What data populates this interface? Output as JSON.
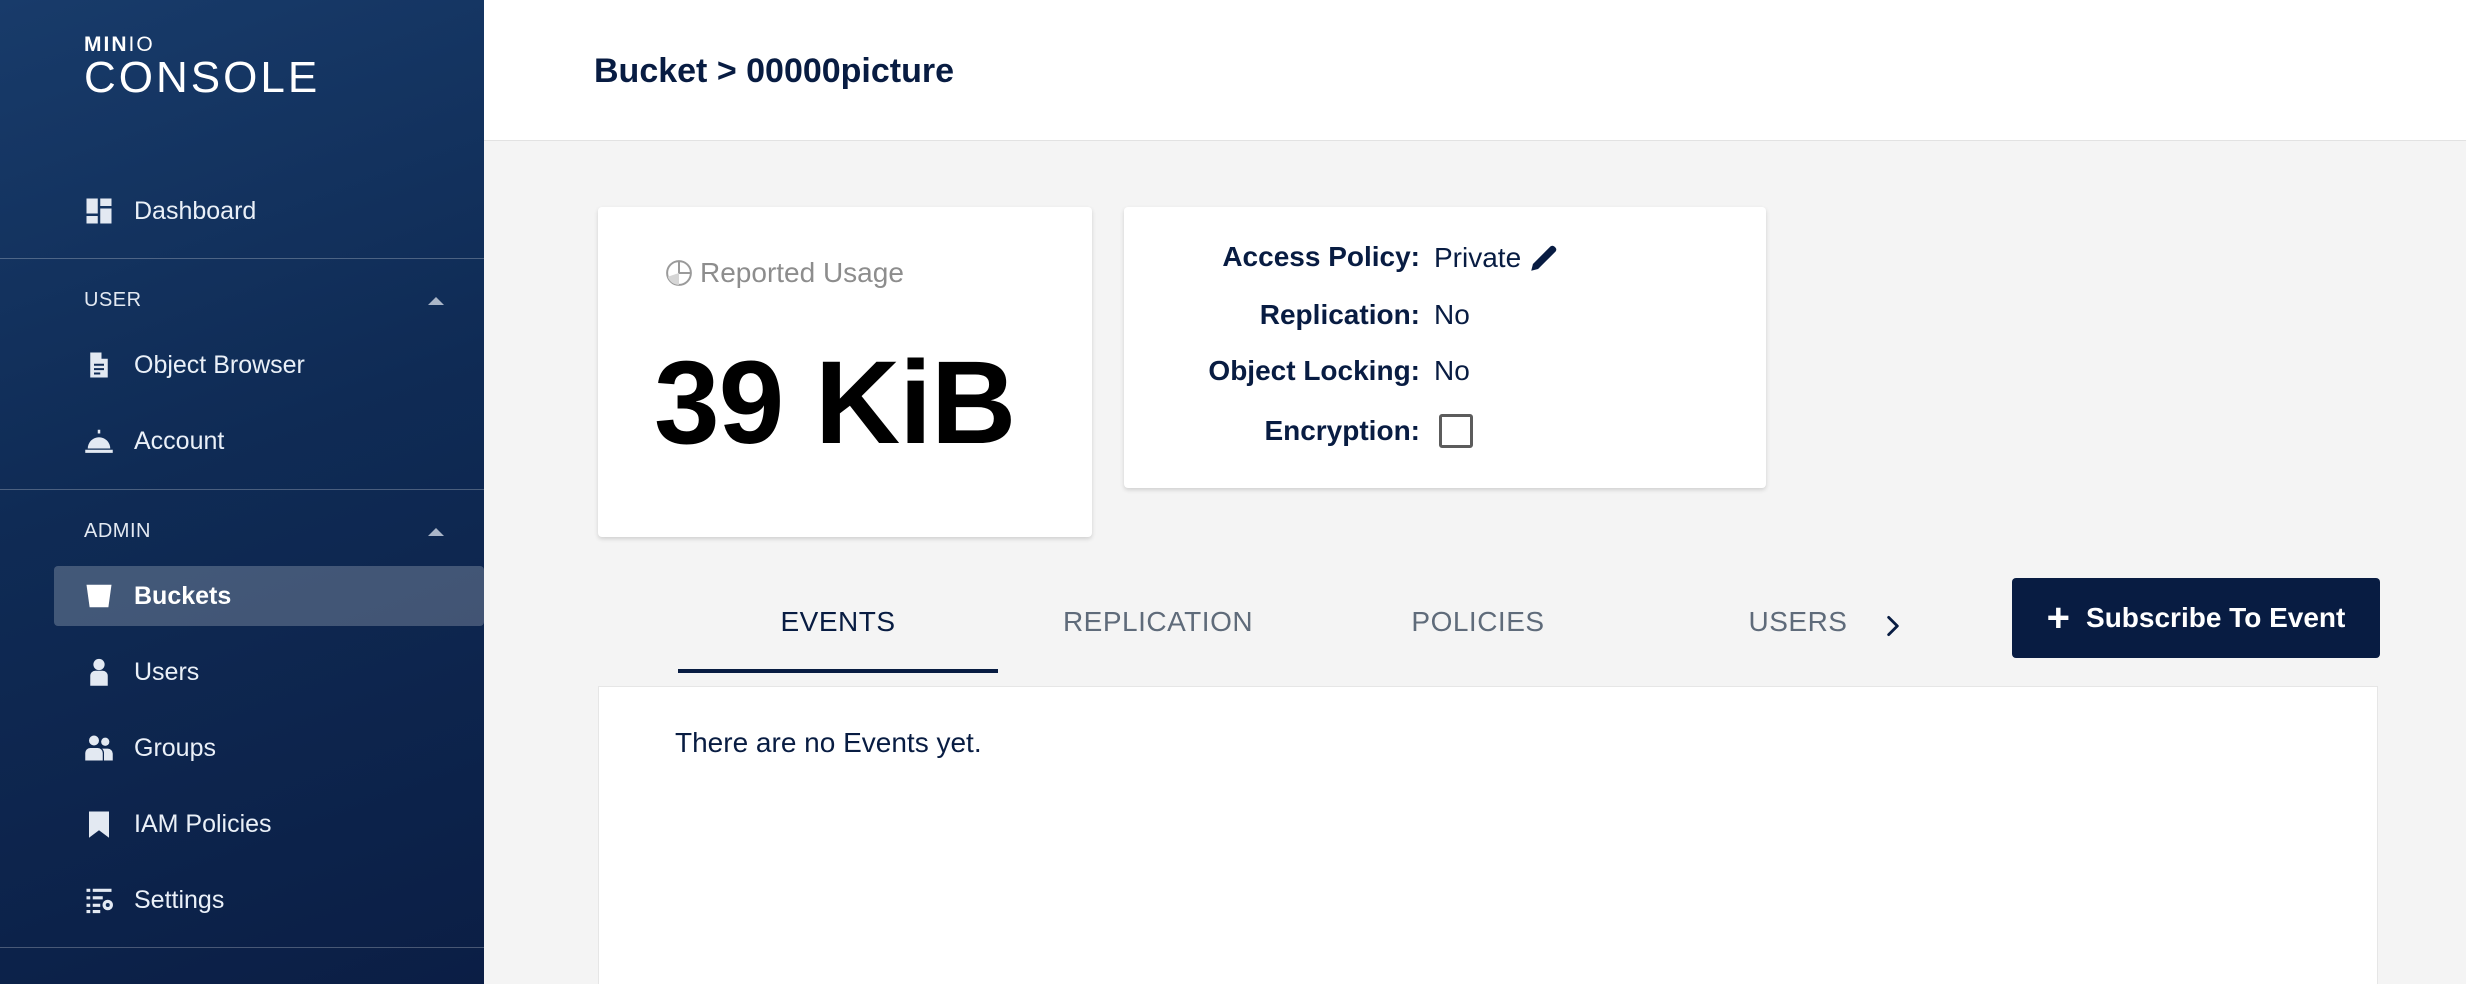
{
  "logo": {
    "top_bold": "MIN",
    "top_light": "IO",
    "main": "CONSOLE"
  },
  "sidebar": {
    "dashboard": "Dashboard",
    "user_section": "USER",
    "user_items": [
      "Object Browser",
      "Account"
    ],
    "admin_section": "ADMIN",
    "admin_items": [
      "Buckets",
      "Users",
      "Groups",
      "IAM Policies",
      "Settings"
    ],
    "selected": "Buckets"
  },
  "header": {
    "title": "Bucket > 00000picture"
  },
  "usage": {
    "label": "Reported Usage",
    "value": "39 KiB"
  },
  "info": {
    "access_policy_label": "Access Policy:",
    "access_policy_value": "Private",
    "replication_label": "Replication:",
    "replication_value": "No",
    "locking_label": "Object Locking:",
    "locking_value": "No",
    "encryption_label": "Encryption:",
    "encryption_checked": false
  },
  "tabs": [
    "EVENTS",
    "REPLICATION",
    "POLICIES",
    "USERS"
  ],
  "active_tab": "EVENTS",
  "subscribe_button": "Subscribe To Event",
  "events": {
    "empty_message": "There are no Events yet."
  },
  "colors": {
    "primary": "#081c42",
    "sidebar": "#0f2b55",
    "muted": "#8d8d8d"
  }
}
